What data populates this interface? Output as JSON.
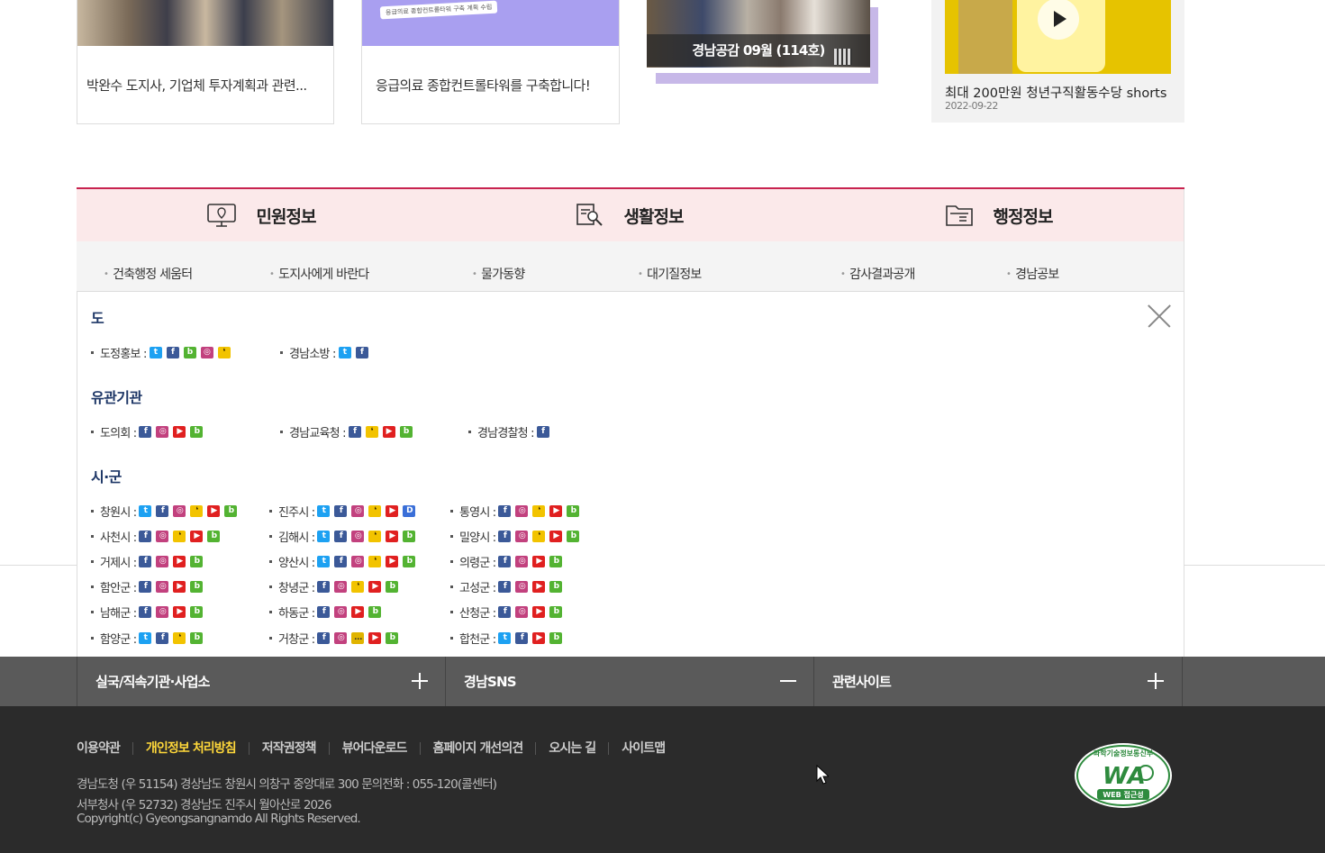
{
  "cards": [
    {
      "caption": "박완수 도지사, 기업체 투자계획과 관련..."
    },
    {
      "caption": "응급의료 종합컨트롤타워를 구축합니다!",
      "banner_text": "응급의료 종합컨트롤타워 구축 계획 수립"
    },
    {
      "overlay_title": "경남공감 09월 (114호)"
    },
    {
      "caption": "최대 200만원 청년구직활동수당 shorts",
      "date": "2022-09-22"
    }
  ],
  "info_tabs": [
    {
      "title": "민원정보",
      "links": [
        "건축행정 세움터",
        "도지사에게 바란다"
      ],
      "icon": "monitor-location-icon"
    },
    {
      "title": "생활정보",
      "links": [
        "물가동향",
        "대기질정보"
      ],
      "icon": "document-search-icon"
    },
    {
      "title": "행정정보",
      "links": [
        "감사결과공개",
        "경남공보"
      ],
      "icon": "folder-icon"
    }
  ],
  "sns_panel": {
    "sections": [
      {
        "title": "도",
        "items": [
          {
            "label": "도정홍보 :",
            "icons": [
              "t",
              "f",
              "b",
              "i",
              "k"
            ]
          },
          {
            "label": "경남소방 :",
            "icons": [
              "t",
              "f"
            ]
          }
        ]
      },
      {
        "title": "유관기관",
        "items": [
          {
            "label": "도의회 :",
            "icons": [
              "f",
              "i",
              "y",
              "b"
            ]
          },
          {
            "label": "경남교육청 :",
            "icons": [
              "f",
              "k",
              "y",
              "b"
            ]
          },
          {
            "label": "경남경찰청 :",
            "icons": [
              "f"
            ]
          }
        ]
      },
      {
        "title": "시·군",
        "items": [
          {
            "label": "창원시 :",
            "icons": [
              "t",
              "f",
              "i",
              "k",
              "y",
              "b"
            ]
          },
          {
            "label": "진주시 :",
            "icons": [
              "t",
              "f",
              "i",
              "k",
              "y",
              "d"
            ]
          },
          {
            "label": "통영시 :",
            "icons": [
              "f",
              "i",
              "k",
              "y",
              "b"
            ]
          },
          {
            "label": "사천시 :",
            "icons": [
              "f",
              "i",
              "k",
              "y",
              "b"
            ]
          },
          {
            "label": "김해시 :",
            "icons": [
              "t",
              "f",
              "i",
              "k",
              "y",
              "b"
            ]
          },
          {
            "label": "밀양시 :",
            "icons": [
              "f",
              "i",
              "k",
              "y",
              "b"
            ]
          },
          {
            "label": "거제시 :",
            "icons": [
              "f",
              "i",
              "y",
              "b"
            ]
          },
          {
            "label": "양산시 :",
            "icons": [
              "t",
              "f",
              "i",
              "k",
              "y",
              "b"
            ]
          },
          {
            "label": "의령군 :",
            "icons": [
              "f",
              "i",
              "y",
              "b"
            ]
          },
          {
            "label": "함안군 :",
            "icons": [
              "f",
              "i",
              "y",
              "b"
            ]
          },
          {
            "label": "창녕군 :",
            "icons": [
              "f",
              "i",
              "k",
              "y",
              "b"
            ]
          },
          {
            "label": "고성군 :",
            "icons": [
              "f",
              "i",
              "y",
              "b"
            ]
          },
          {
            "label": "남해군 :",
            "icons": [
              "f",
              "i",
              "y",
              "b"
            ]
          },
          {
            "label": "하동군 :",
            "icons": [
              "f",
              "i",
              "y",
              "b"
            ]
          },
          {
            "label": "산청군 :",
            "icons": [
              "f",
              "i",
              "y",
              "b"
            ]
          },
          {
            "label": "함양군 :",
            "icons": [
              "t",
              "f",
              "k",
              "b"
            ]
          },
          {
            "label": "거창군 :",
            "icons": [
              "f",
              "i",
              "s",
              "y",
              "b"
            ]
          },
          {
            "label": "합천군 :",
            "icons": [
              "t",
              "f",
              "y",
              "b"
            ]
          }
        ]
      }
    ],
    "icon_names": {
      "t": "twitter-icon",
      "f": "facebook-icon",
      "b": "blog-icon",
      "i": "instagram-icon",
      "k": "kakaostory-icon",
      "y": "youtube-icon",
      "d": "daum-icon",
      "s": "talk-icon"
    },
    "icon_glyphs": {
      "t": "t",
      "f": "f",
      "b": "b",
      "i": "◎",
      "k": "❛",
      "y": "▶",
      "d": "D",
      "s": "…"
    }
  },
  "bottom_tabs": [
    {
      "label": "실국/직속기관·사업소",
      "state": "plus"
    },
    {
      "label": "경남SNS",
      "state": "minus"
    },
    {
      "label": "관련사이트",
      "state": "plus"
    }
  ],
  "footer": {
    "links": [
      "이용약관",
      "개인정보 처리방침",
      "저작권정책",
      "뷰어다운로드",
      "홈페이지 개선의견",
      "오시는 길",
      "사이트맵"
    ],
    "highlight_index": 1,
    "address1": "경남도청 (우 51154) 경상남도 창원시 의창구 중앙대로 300 문의전화 : 055-120(콜센터)",
    "address2": "서부청사 (우 52732) 경상남도 진주시 월아산로 2026",
    "copyright": "Copyright(c) Gyeongsangnamdo All Rights Reserved.",
    "badge": {
      "top": "과학기술정보통신부",
      "mark": "WA",
      "bottom": "WEB 접근성"
    }
  },
  "colors": {
    "accent": "#c8234f",
    "tab_bg": "#fbe9ea",
    "footer_bg": "#2b2b2b",
    "bar_bg": "#5a5a5a",
    "highlight": "#ffd83a",
    "panel_title": "#1d3666"
  }
}
